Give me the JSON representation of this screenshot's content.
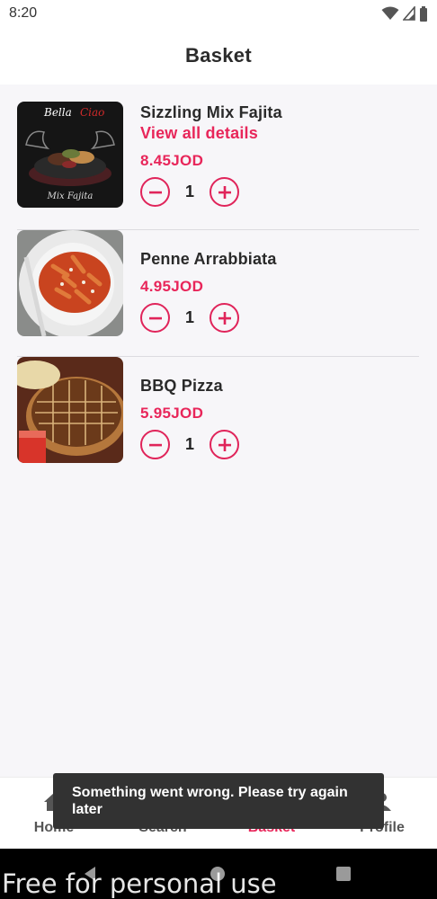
{
  "status_bar": {
    "time": "8:20"
  },
  "header": {
    "title": "Basket"
  },
  "items": [
    {
      "name": "Sizzling Mix Fajita",
      "link": "View all details",
      "price": "8.45JOD",
      "quantity": "1",
      "image_text": [
        "Bella",
        "Mix Fajita"
      ]
    },
    {
      "name": "Penne Arrabbiata",
      "price": "4.95JOD",
      "quantity": "1"
    },
    {
      "name": "BBQ Pizza",
      "price": "5.95JOD",
      "quantity": "1"
    }
  ],
  "bottom_nav": {
    "items": [
      {
        "label": "Home",
        "icon": "home-icon"
      },
      {
        "label": "Search",
        "icon": "search-icon"
      },
      {
        "label": "Basket",
        "icon": "basket-icon"
      },
      {
        "label": "Profile",
        "icon": "profile-icon"
      }
    ],
    "active": "Basket"
  },
  "snackbar": {
    "message": "Something went wrong. Please try again later"
  },
  "watermark": "Free for personal use",
  "colors": {
    "accent": "#e8265a",
    "snackbar": "#323232",
    "background": "#f7f6f9"
  }
}
